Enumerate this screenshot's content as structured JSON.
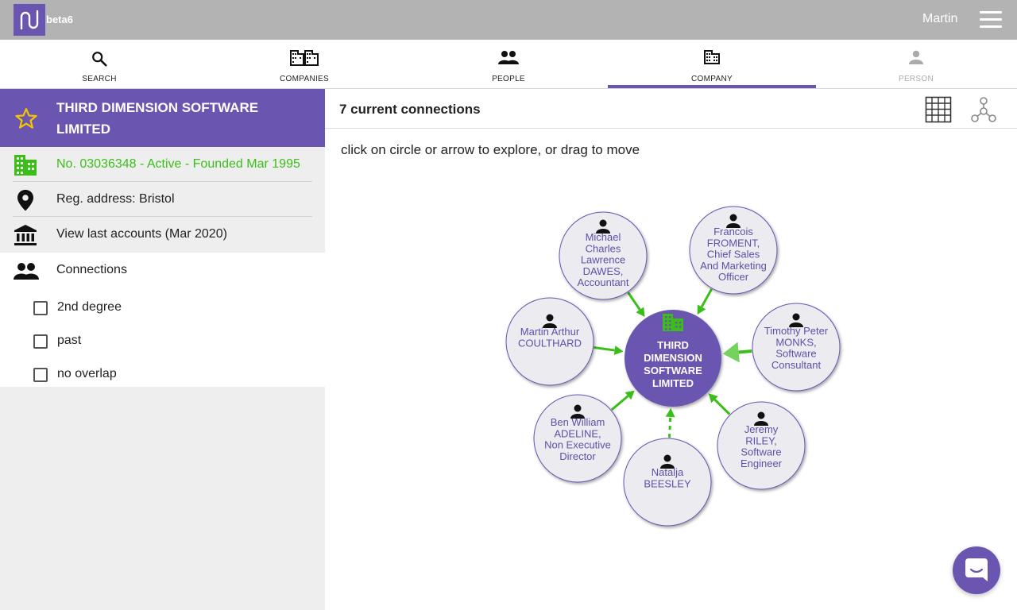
{
  "app": {
    "beta": "beta6",
    "user": "Martin"
  },
  "nav": {
    "tabs": [
      {
        "label": "SEARCH",
        "icon": "search-icon"
      },
      {
        "label": "COMPANIES",
        "icon": "companies-icon"
      },
      {
        "label": "PEOPLE",
        "icon": "people-icon"
      },
      {
        "label": "COMPANY",
        "icon": "company-icon",
        "active": true
      },
      {
        "label": "PERSON",
        "icon": "person-icon",
        "disabled": true
      }
    ]
  },
  "company": {
    "name": "THIRD DIMENSION SOFTWARE LIMITED",
    "status": "No. 03036348 - Active - Founded Mar 1995",
    "address": "Reg. address: Bristol",
    "accounts": "View last accounts (Mar 2020)",
    "connections_label": "Connections"
  },
  "options": {
    "items": [
      "2nd degree",
      "past",
      "no overlap"
    ]
  },
  "main": {
    "title": "7 current connections",
    "hint": "click on circle or arrow to explore, or drag to move"
  },
  "graph": {
    "center": {
      "lines": [
        "THIRD",
        "DIMENSION",
        "SOFTWARE",
        "LIMITED"
      ]
    },
    "nodes": [
      {
        "lines": [
          "Michael",
          "Charles",
          "Lawrence",
          "DAWES,",
          "Accountant"
        ]
      },
      {
        "lines": [
          "Francois",
          "FROMENT,",
          "Chief Sales",
          "And Marketing",
          "Officer"
        ]
      },
      {
        "lines": [
          "Martin Arthur",
          "COULTHARD"
        ]
      },
      {
        "lines": [
          "Timothy Peter",
          "MONKS,",
          "Software",
          "Consultant"
        ]
      },
      {
        "lines": [
          "Ben William",
          "ADELINE,",
          "Non Executive",
          "Director"
        ]
      },
      {
        "lines": [
          "Jeremy",
          "RILEY,",
          "Software",
          "Engineer"
        ]
      },
      {
        "lines": [
          "Natalja",
          "BEESLEY"
        ]
      }
    ]
  },
  "colors": {
    "brand": "#6a55b0",
    "active_green": "#3bbf18",
    "node_fill": "#ebebf0"
  }
}
